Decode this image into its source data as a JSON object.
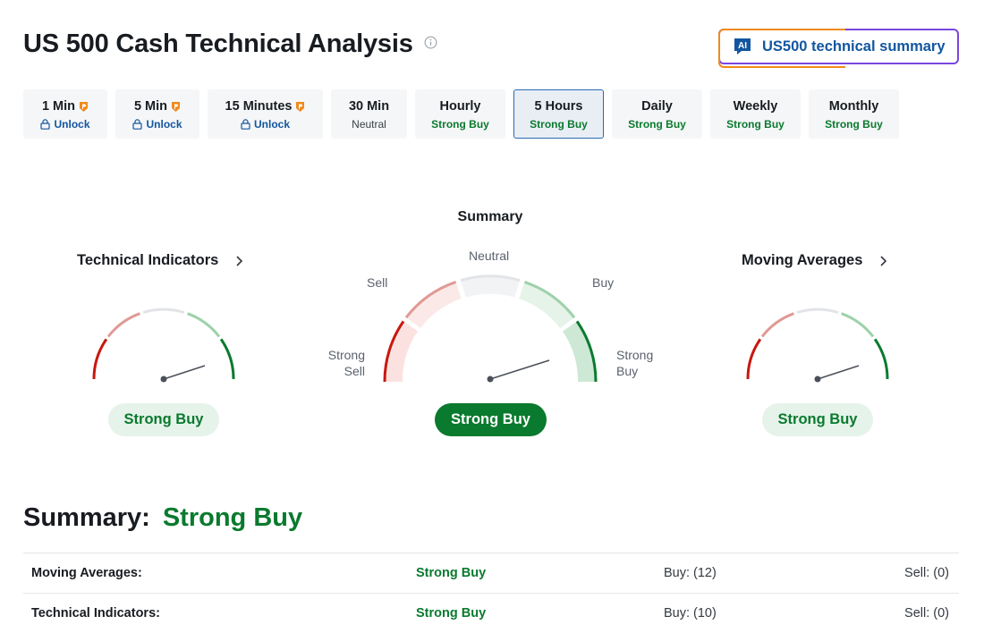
{
  "page": {
    "title": "US 500 Cash Technical Analysis",
    "ai_button_badge": "AI",
    "ai_button_label": "US500 technical summary"
  },
  "timeframes": [
    {
      "name": "1 Min",
      "status": "Unlock",
      "locked": true
    },
    {
      "name": "5 Min",
      "status": "Unlock",
      "locked": true
    },
    {
      "name": "15 Minutes",
      "status": "Unlock",
      "locked": true
    },
    {
      "name": "30 Min",
      "status": "Neutral",
      "locked": false
    },
    {
      "name": "Hourly",
      "status": "Strong Buy",
      "locked": false
    },
    {
      "name": "5 Hours",
      "status": "Strong Buy",
      "locked": false,
      "active": true
    },
    {
      "name": "Daily",
      "status": "Strong Buy",
      "locked": false
    },
    {
      "name": "Weekly",
      "status": "Strong Buy",
      "locked": false
    },
    {
      "name": "Monthly",
      "status": "Strong Buy",
      "locked": false
    }
  ],
  "gauges": {
    "technical_indicators": {
      "title": "Technical Indicators",
      "result": "Strong Buy"
    },
    "summary": {
      "title": "Summary",
      "result": "Strong Buy",
      "labels": {
        "neutral": "Neutral",
        "sell": "Sell",
        "buy": "Buy",
        "strong_sell_1": "Strong",
        "strong_sell_2": "Sell",
        "strong_buy_1": "Strong",
        "strong_buy_2": "Buy"
      }
    },
    "moving_averages": {
      "title": "Moving Averages",
      "result": "Strong Buy"
    }
  },
  "summary": {
    "label": "Summary:",
    "value": "Strong Buy"
  },
  "table": [
    {
      "name": "Moving Averages:",
      "value": "Strong Buy",
      "buy": "Buy: (12)",
      "sell": "Sell: (0)"
    },
    {
      "name": "Technical Indicators:",
      "value": "Strong Buy",
      "buy": "Buy: (10)",
      "sell": "Sell: (0)"
    }
  ],
  "colors": {
    "strong_buy": "#0a7a2e",
    "link_blue": "#1256a0",
    "sell_red": "#c9170e"
  }
}
